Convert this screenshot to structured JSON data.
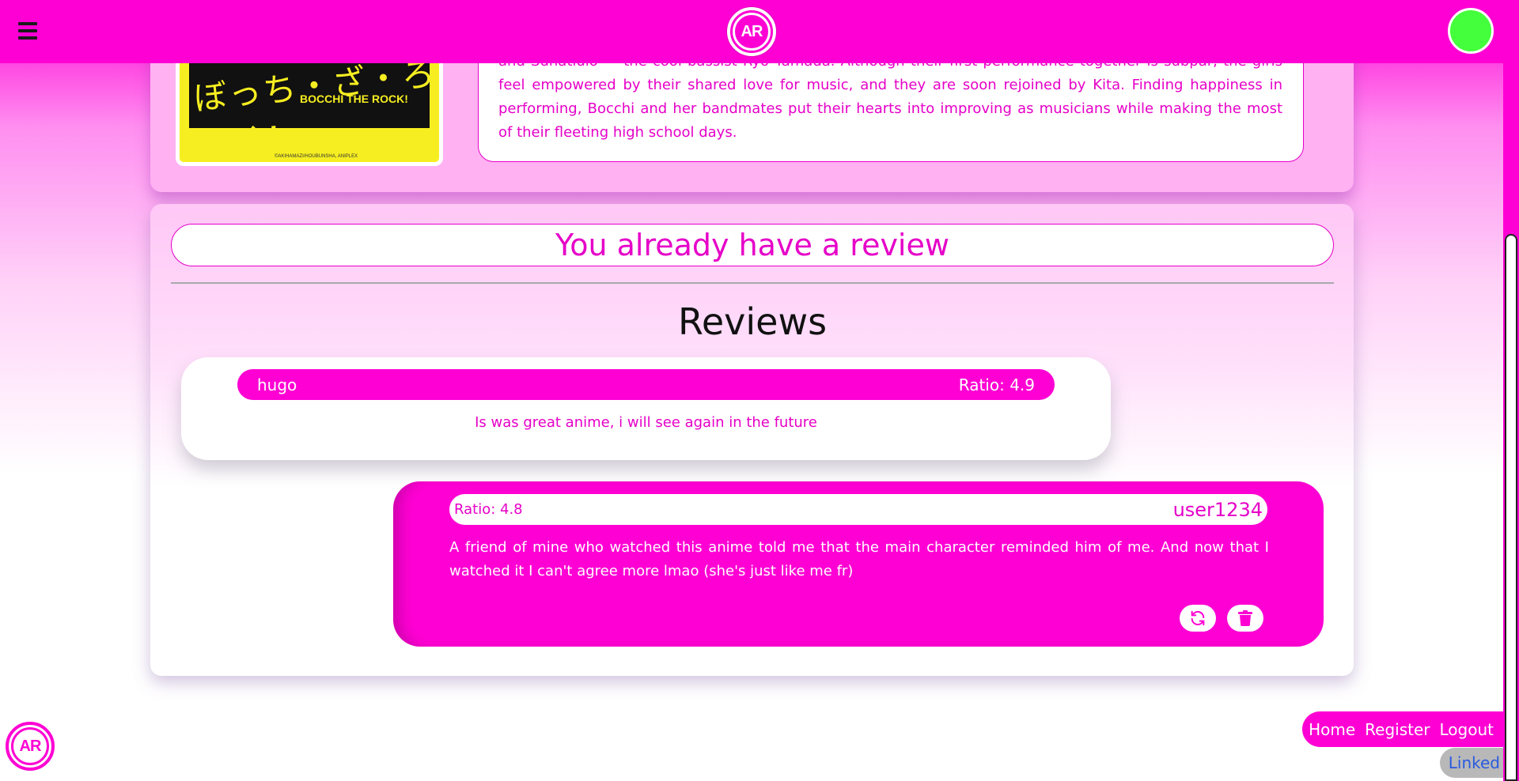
{
  "header": {
    "logo_text": "AR"
  },
  "anime": {
    "poster_title_jp": "ぼっち・ざ・ろっく!",
    "poster_title_en": "BOCCHI THE ROCK!",
    "poster_credit": "©AKIHAMAZI/HOUBUNSHA, ANIPLEX",
    "synopsis": "and Sunatlulo — the cool bassist Ryo Yamada. Although their first performance together is subpar, the girls feel empowered by their shared love for music, and they are soon rejoined by Kita. Finding happiness in performing, Bocchi and her bandmates put their hearts into improving as musicians while making the most of their fleeting high school days."
  },
  "review_section": {
    "already_message": "You already have a review",
    "title": "Reviews",
    "reviews": [
      {
        "user": "hugo",
        "ratio": "Ratio: 4.9",
        "text": "Is was great anime, i will see again in the future"
      },
      {
        "user": "user1234",
        "ratio": "Ratio: 4.8",
        "text": "A friend of mine who watched this anime told me that the main character reminded him of me. And now that I watched it I can't agree more lmao (she's just like me fr)"
      }
    ]
  },
  "footer": {
    "logo_text": "AR",
    "nav": [
      "Home",
      "Register",
      "Logout"
    ],
    "linked": "Linked"
  },
  "colors": {
    "brand": "#ff00d4",
    "accent_text": "#e600c8",
    "avatar": "#44ff3c"
  },
  "icons": {
    "menu": "hamburger-icon",
    "edit": "refresh-icon",
    "delete": "trash-icon"
  }
}
